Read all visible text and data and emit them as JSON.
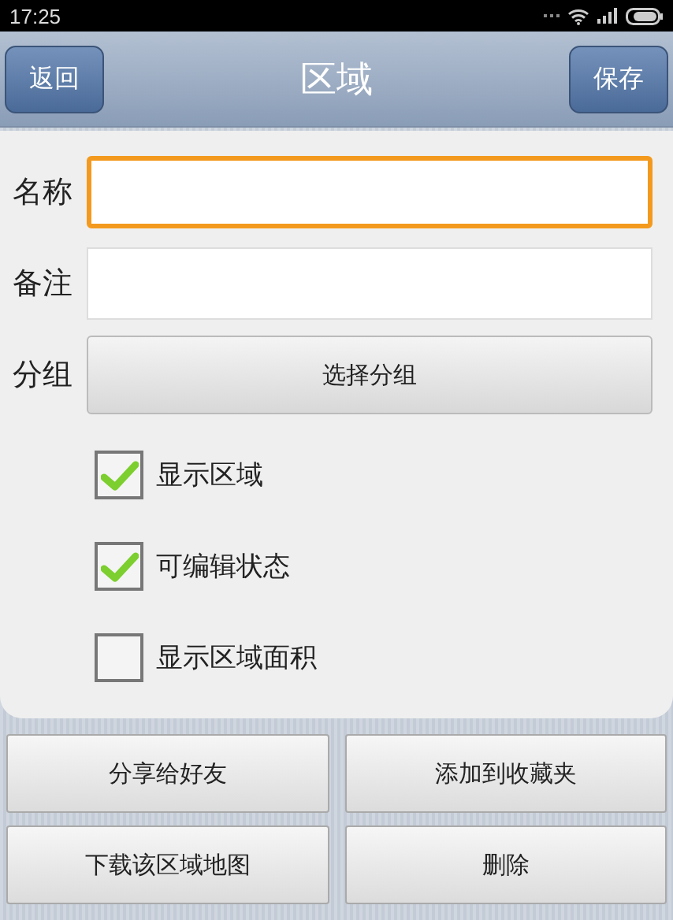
{
  "status_bar": {
    "time": "17:25"
  },
  "nav_bar": {
    "back": "返回",
    "title": "区域",
    "save": "保存"
  },
  "fields": [
    {
      "label": "名称",
      "focused": true
    },
    {
      "label": "备注",
      "focused": false
    }
  ],
  "group": {
    "label": "分组",
    "button": "选择分组"
  },
  "checkboxes": [
    {
      "label": "显示区域",
      "checked": true
    },
    {
      "label": "可编辑状态",
      "checked": true
    },
    {
      "label": "显示区域面积",
      "checked": false
    }
  ],
  "actions": [
    "分享给好友",
    "添加到收藏夹",
    "下载该区域地图",
    "删除"
  ]
}
